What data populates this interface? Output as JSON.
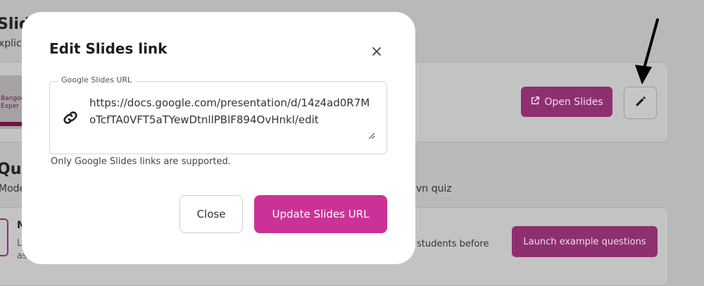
{
  "background": {
    "slides_title": "Slid",
    "slides_subtitle": "xplic",
    "thumb_lines": [
      "Bangor",
      "Exper"
    ],
    "open_slides_label": "Open Slides",
    "quiz_title": "Qui",
    "quiz_subtitle": "Mode",
    "quiz_subtitle_tail": "vn quiz",
    "quiz_item_title": "M",
    "quiz_item_line1": "L",
    "quiz_item_line2": "as",
    "students_text": "students before",
    "launch_label": "Launch example questions"
  },
  "modal": {
    "title": "Edit Slides link",
    "field_legend": "Google Slides URL",
    "url_value": "https://docs.google.com/presentation/d/14z4ad0R7MoTcfTA0VFT5aTYewDtnllPBlF894OvHnkl/edit",
    "hint": "Only Google Slides links are supported.",
    "close_label": "Close",
    "update_label": "Update Slides URL"
  },
  "icons": [
    "close-icon",
    "link-icon",
    "resize-handle-icon",
    "external-link-icon",
    "pencil-icon",
    "arrow-annotation-icon"
  ],
  "colors": {
    "primary": "#cb3297",
    "primary_dimmed": "#8e2f6f",
    "overlay": "#b9b9b9"
  }
}
